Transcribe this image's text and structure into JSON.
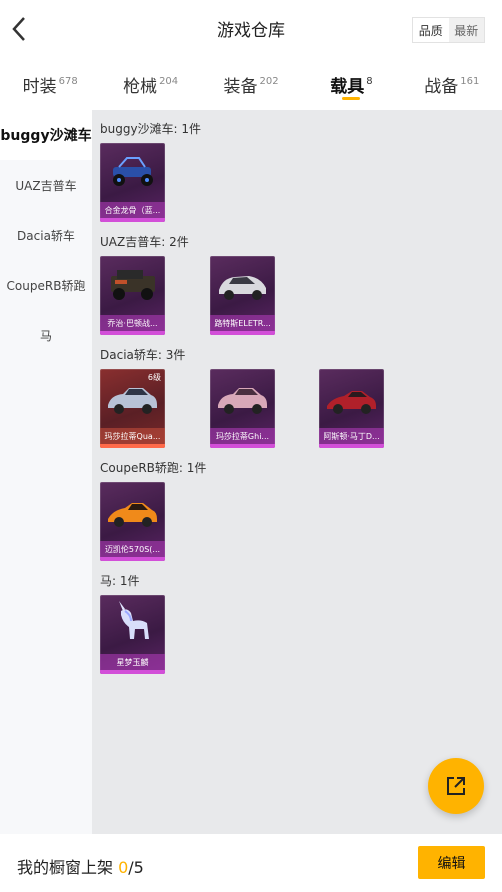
{
  "header": {
    "title": "游戏仓库",
    "sort": [
      "品质",
      "最新"
    ]
  },
  "tabs": [
    {
      "label": "时装",
      "count": "678"
    },
    {
      "label": "枪械",
      "count": "204"
    },
    {
      "label": "装备",
      "count": "202"
    },
    {
      "label": "载具",
      "count": "8"
    },
    {
      "label": "战备",
      "count": "161"
    }
  ],
  "sidebar": [
    "buggy沙滩车",
    "UAZ吉普车",
    "Dacia轿车",
    "CoupeRB轿跑",
    "马"
  ],
  "sections": {
    "buggy": {
      "title": "buggy沙滩车: 1件",
      "items": [
        {
          "name": "合金龙骨（蓝..."
        }
      ]
    },
    "uaz": {
      "title": "UAZ吉普车: 2件",
      "items": [
        {
          "name": "乔治·巴顿战..."
        },
        {
          "name": "路特斯ELETR..."
        }
      ]
    },
    "dacia": {
      "title": "Dacia轿车: 3件",
      "items": [
        {
          "name": "玛莎拉蒂Qua...",
          "level": "6级"
        },
        {
          "name": "玛莎拉蒂Ghi..."
        },
        {
          "name": "阿斯顿·马丁D..."
        }
      ]
    },
    "coupe": {
      "title": "CoupeRB轿跑: 1件",
      "items": [
        {
          "name": "迈凯伦570S(..."
        }
      ]
    },
    "horse": {
      "title": "马: 1件",
      "items": [
        {
          "name": "星梦玉麟"
        }
      ]
    }
  },
  "footer": {
    "label": "我的橱窗上架 ",
    "shelved": "0",
    "total": "/5",
    "edit_label": "编辑"
  },
  "colors": {
    "accent": "#ffb300",
    "card_purple": "#3b1a44",
    "card_orange": "#5a1f25"
  }
}
